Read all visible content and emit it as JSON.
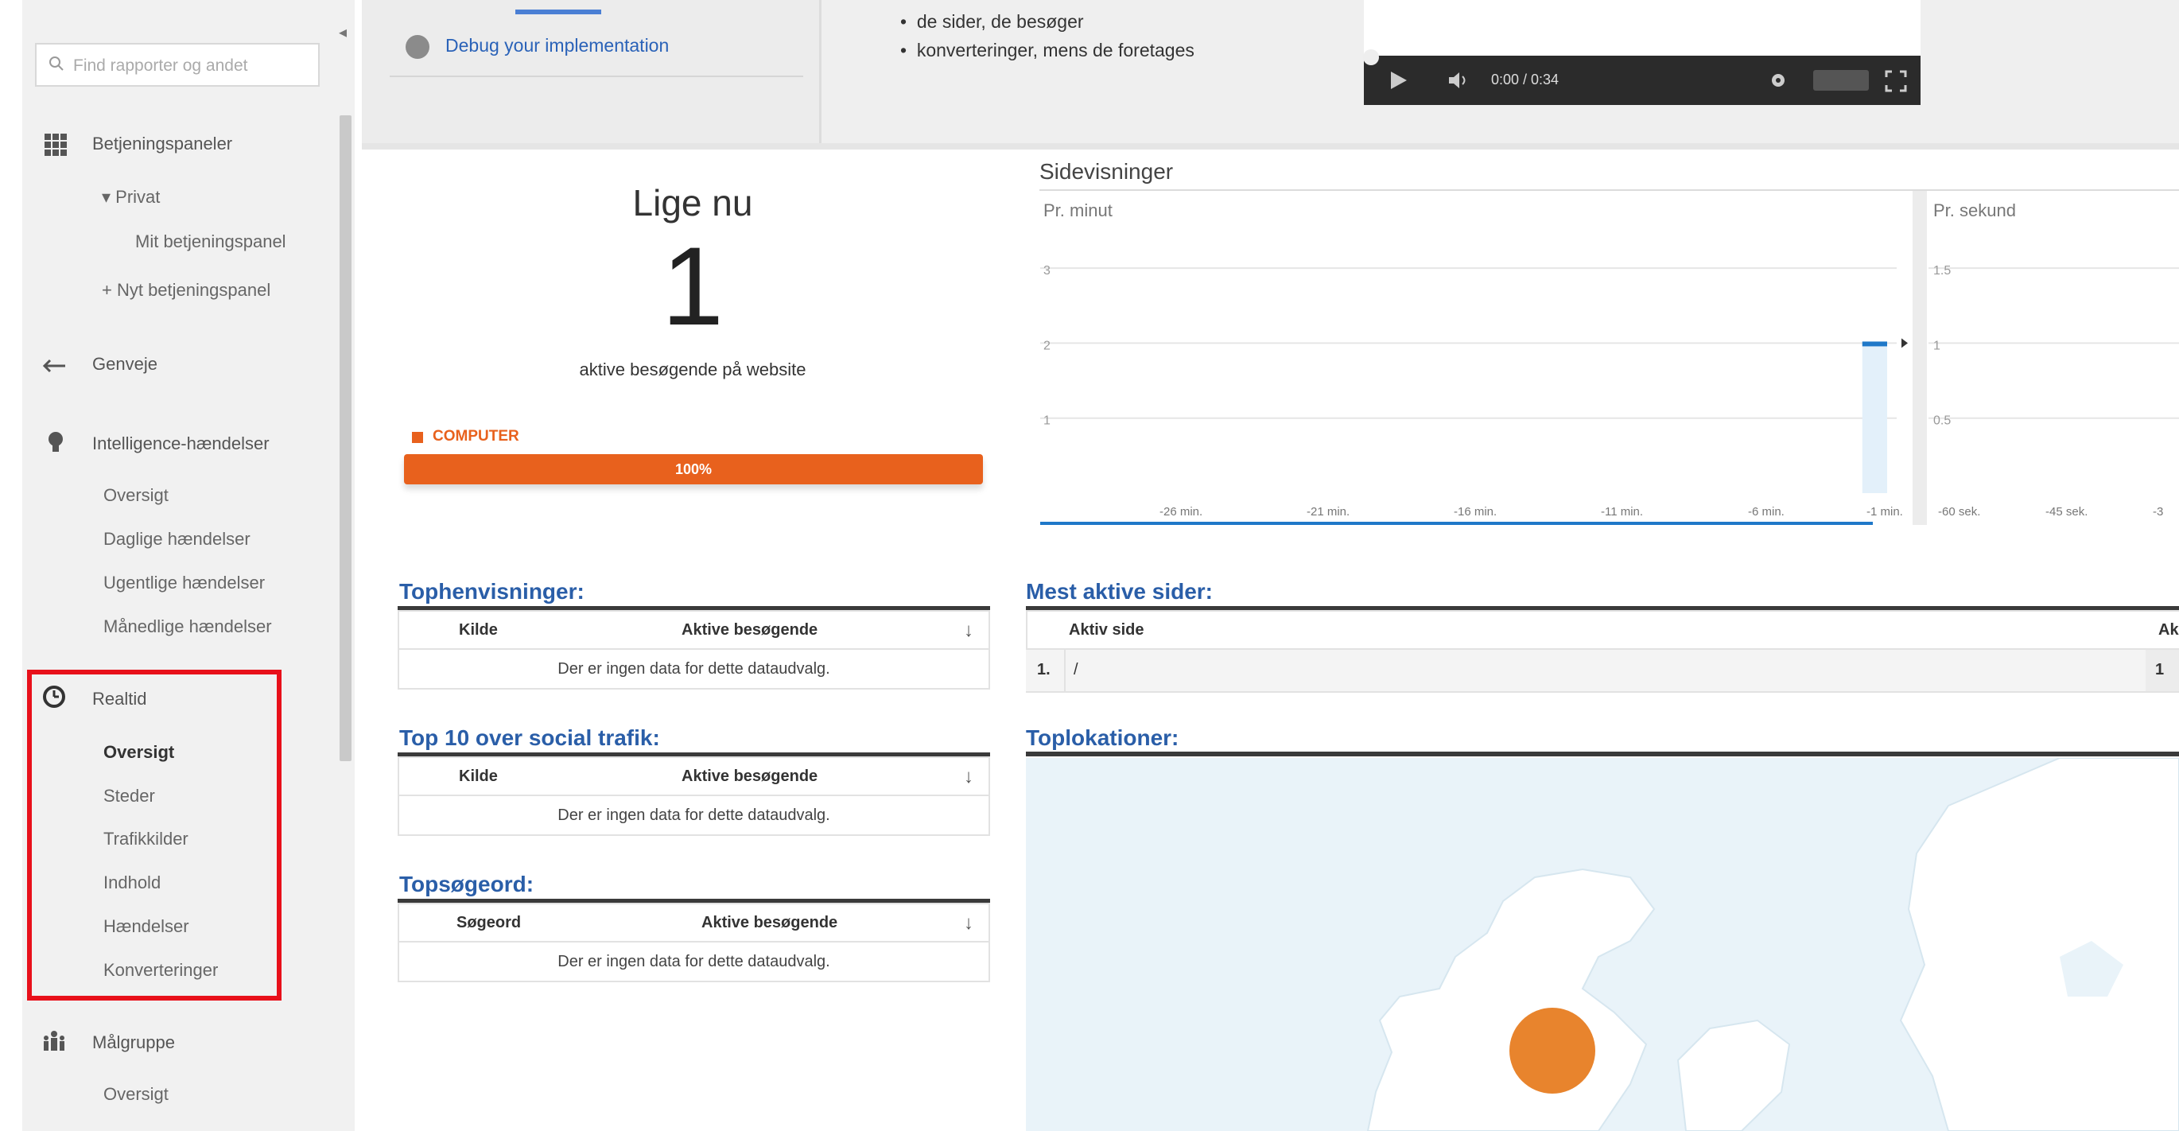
{
  "sidebar": {
    "search_placeholder": "Find rapporter og andet",
    "sections": [
      {
        "label": "Betjeningspaneler",
        "icon": "grid-icon"
      },
      {
        "label": "Genveje",
        "icon": "shortcut-arrow-icon"
      },
      {
        "label": "Intelligence-hændelser",
        "icon": "lightbulb-icon"
      },
      {
        "label": "Realtid",
        "icon": "clock-icon"
      },
      {
        "label": "Målgruppe",
        "icon": "audience-icon"
      }
    ],
    "dashboards": {
      "private": "▾ Privat",
      "my_dashboard": "Mit betjeningspanel",
      "new_dashboard": "+ Nyt betjeningspanel"
    },
    "intelligence_items": [
      "Oversigt",
      "Daglige hændelser",
      "Ugentlige hændelser",
      "Månedlige hændelser"
    ],
    "realtime_items": [
      "Oversigt",
      "Steder",
      "Trafikkilder",
      "Indhold",
      "Hændelser",
      "Konverteringer"
    ],
    "audience_items": [
      "Oversigt"
    ]
  },
  "top": {
    "debug_link": "Debug your implementation",
    "bullets": [
      "de sider, de besøger",
      "konverteringer, mens de foretages"
    ],
    "video_time": "0:00 / 0:34"
  },
  "right_now": {
    "title": "Lige nu",
    "count": "1",
    "label": "aktive besøgende på website",
    "device_label": "COMPUTER",
    "device_percent": "100%",
    "device_fraction": 1.0,
    "device_color": "#e8611d"
  },
  "chart_data": [
    {
      "type": "bar",
      "title": "Sidevisninger",
      "subtitle": "Pr. minut",
      "y_ticks": [
        "3",
        "2",
        "1"
      ],
      "ylim": [
        0,
        3.5
      ],
      "x_ticks": [
        "-26 min.",
        "-21 min.",
        "-16 min.",
        "-11 min.",
        "-6 min.",
        "-1 min."
      ],
      "values": [
        0,
        0,
        0,
        0,
        0,
        0,
        0,
        0,
        0,
        0,
        0,
        0,
        0,
        0,
        0,
        0,
        0,
        0,
        0,
        0,
        0,
        0,
        0,
        0,
        0,
        0,
        0,
        0,
        0,
        2
      ]
    },
    {
      "type": "bar",
      "subtitle": "Pr. sekund",
      "y_ticks": [
        "1.5",
        "1",
        "0.5"
      ],
      "ylim": [
        0,
        1.75
      ],
      "x_ticks": [
        "-60 sek.",
        "-45 sek.",
        "-3"
      ],
      "values": []
    }
  ],
  "tables": {
    "top_referrals": {
      "title": "Tophenvisninger:",
      "col1": "Kilde",
      "col2": "Aktive besøgende",
      "empty": "Der er ingen data for dette dataudvalg."
    },
    "top_social": {
      "title": "Top 10 over social trafik:",
      "col1": "Kilde",
      "col2": "Aktive besøgende",
      "empty": "Der er ingen data for dette dataudvalg."
    },
    "top_keywords": {
      "title": "Topsøgeord:",
      "col1": "Søgeord",
      "col2": "Aktive besøgende",
      "empty": "Der er ingen data for dette dataudvalg."
    },
    "top_pages": {
      "title": "Mest aktive sider:",
      "col1": "Aktiv side",
      "col2": "Ak",
      "rows": [
        {
          "rank": "1.",
          "page": "/",
          "count": "1"
        }
      ]
    }
  },
  "map": {
    "title": "Toplokationer:",
    "marker_color": "#e8842d",
    "ocean_color": "#e9f3f9",
    "land_color": "#ffffff"
  }
}
